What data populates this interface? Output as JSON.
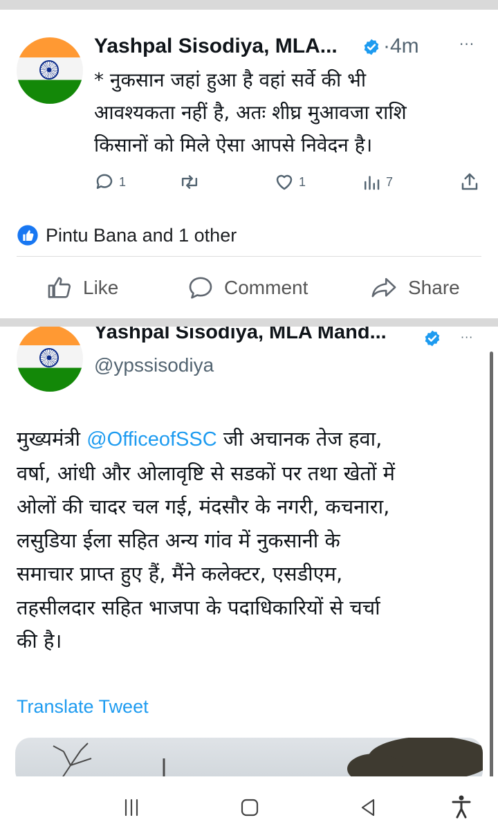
{
  "post1": {
    "name": "Yashpal Sisodiya, MLA...",
    "time": "·4m",
    "more": "···",
    "lines": [
      "* नुकसान जहां हुआ है वहां सर्वे की भी",
      "आवश्यकता नहीं है, अतः शीघ्र मुआवजा राशि",
      "किसानों को मिले ऐसा आपसे निवेदन है।"
    ],
    "replies": "1",
    "likes": "1",
    "views": "7"
  },
  "facebook": {
    "reactions": "Pintu Bana and 1 other",
    "like": "Like",
    "comment": "Comment",
    "share": "Share"
  },
  "post2": {
    "name": "Yashpal Sisodiya, MLA Mand...",
    "handle": "@ypssisodiya",
    "more": "···",
    "line1_prefix": "मुख्यमंत्री ",
    "mention": "@OfficeofSSC",
    "line1_suffix": " जी अचानक तेज हवा,",
    "lines": [
      "वर्षा, आंधी और ओलावृष्टि से सडकों पर तथा खेतों में",
      "ओलों की चादर चल गई, मंदसौर के नगरी, कचनारा,",
      "लसुडिया ईला सहित अन्य गांव में नुकसानी के",
      "समाचार प्राप्त हुए हैं, मैंने कलेक्टर, एसडीएम,",
      "तहसीलदार सहित भाजपा के पदाधिकारियों से चर्चा",
      "की है।"
    ],
    "translate": "Translate Tweet"
  },
  "icons": {
    "verified": "verified-badge-icon",
    "reply": "reply-icon",
    "retweet": "retweet-icon",
    "like": "heart-icon",
    "views": "views-icon",
    "share": "share-icon",
    "fb_like": "thumbs-up-icon",
    "fb_comment": "comment-icon",
    "fb_share": "share-arrow-icon",
    "nav_recents": "recents-icon",
    "nav_home": "home-icon",
    "nav_back": "back-icon",
    "nav_accessibility": "accessibility-icon"
  },
  "colors": {
    "twitter_blue": "#1d9bf0",
    "muted": "#536471",
    "fb_blue": "#1877f2"
  }
}
